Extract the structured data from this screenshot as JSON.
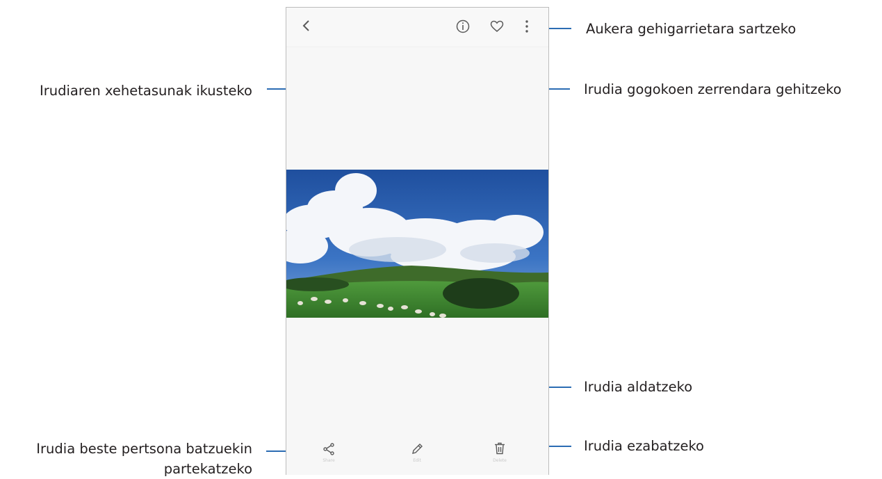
{
  "colors": {
    "callout_line": "#2b6cb3",
    "icon_gray": "#5a5a5a"
  },
  "toolbar_icons": {
    "back": "chevron-left-icon",
    "details": "info-icon",
    "favorite": "heart-icon",
    "more": "more-vertical-icon"
  },
  "bottom_bar": {
    "share_label": "Share",
    "edit_label": "Edit",
    "delete_label": "Delete"
  },
  "callouts": {
    "more_options": "Aukera gehigarrietara sartzeko",
    "details": "Irudiaren xehetasunak ikusteko",
    "favorite": "Irudia gogokoen zerrendara gehitzeko",
    "edit": "Irudia aldatzeko",
    "share_line1": "Irudia beste pertsona batzuekin",
    "share_line2": "partekatzeko",
    "delete": "Irudia ezabatzeko"
  }
}
